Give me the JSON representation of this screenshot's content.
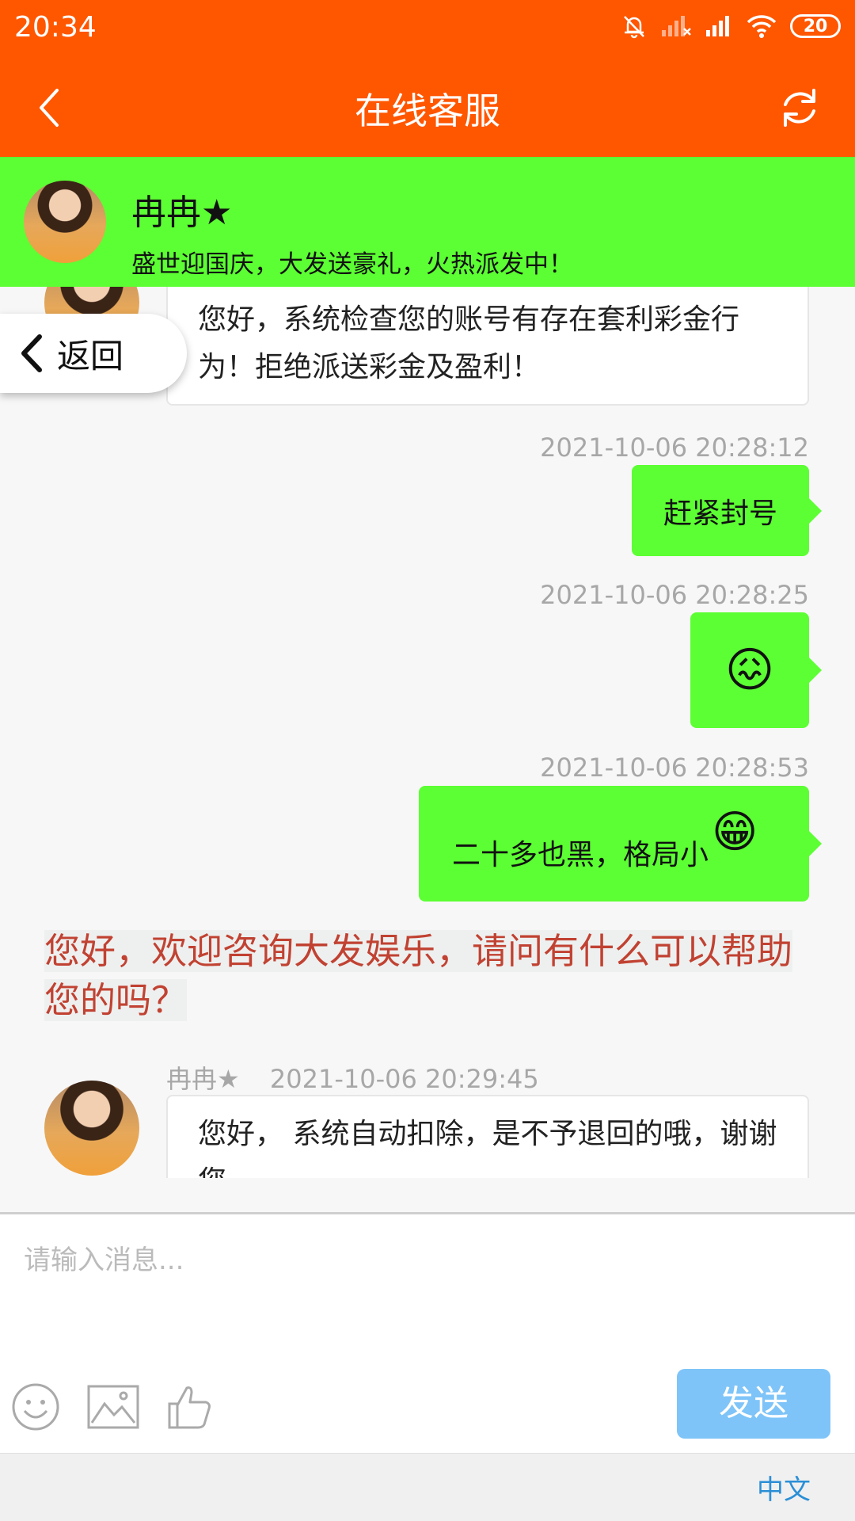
{
  "status_bar": {
    "time": "20:34",
    "battery": "20",
    "icons": [
      "mute-bell-icon",
      "no-signal-icon",
      "signal-icon",
      "wifi-icon",
      "battery-icon"
    ]
  },
  "header": {
    "title": "在线客服",
    "back_icon": "chevron-left-icon",
    "refresh_icon": "refresh-icon"
  },
  "agent": {
    "name": "冉冉★",
    "slogan": "盛世迎国庆，大发送豪礼，火热派发中！"
  },
  "back_pill": {
    "label": "返回"
  },
  "messages": [
    {
      "side": "left",
      "text": "您好，系统检查您的账号有存在套利彩金行为！拒绝派送彩金及盈利！"
    },
    {
      "side": "right",
      "time": "2021-10-06 20:28:12",
      "text": "赶紧封号"
    },
    {
      "side": "right",
      "time": "2021-10-06 20:28:25",
      "emoji": "😖"
    },
    {
      "side": "right",
      "time": "2021-10-06 20:28:53",
      "text": "二十多也黑，格局小",
      "emoji": "😁"
    },
    {
      "side": "system",
      "text": "您好，欢迎咨询大发娱乐，请问有什么可以帮助您的吗？"
    },
    {
      "side": "left",
      "sender": "冉冉★",
      "time": "2021-10-06 20:29:45",
      "text": "您好， 系统自动扣除，是不予退回的哦，谢谢您"
    }
  ],
  "composer": {
    "placeholder": "请输入消息...",
    "send_label": "发送",
    "tool_icons": [
      "smile-icon",
      "image-icon",
      "thumbs-up-icon"
    ]
  },
  "footer": {
    "language": "中文"
  },
  "colors": {
    "header_bg": "#ff5600",
    "agent_bg": "#5cff33",
    "bubble_right": "#5cff33",
    "system_text": "#c14232",
    "send_button": "#7ec4f8",
    "language_link": "#2b8fd6"
  }
}
